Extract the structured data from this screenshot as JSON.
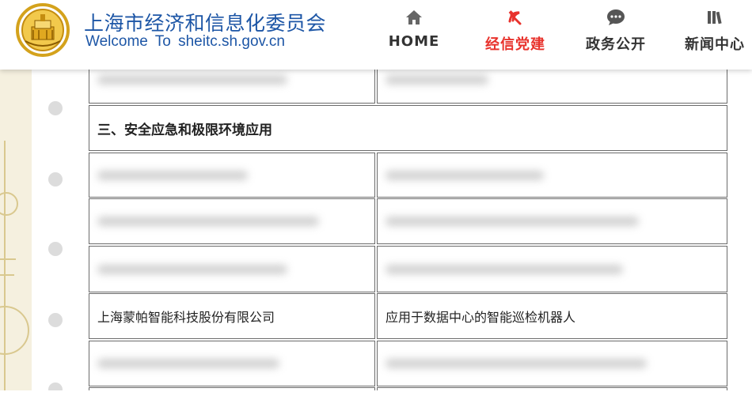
{
  "header": {
    "title": "上海市经济和信息化委员会",
    "subtitle": "Welcome To sheitc.sh.gov.cn",
    "nav": [
      {
        "id": "home",
        "label": "HOME",
        "icon": "home-icon",
        "active": false
      },
      {
        "id": "party",
        "label": "经信党建",
        "icon": "hammer-sickle-icon",
        "active": true
      },
      {
        "id": "gov",
        "label": "政务公开",
        "icon": "chat-bubble-icon",
        "active": false
      },
      {
        "id": "news",
        "label": "新闻中心",
        "icon": "books-icon",
        "active": false
      }
    ]
  },
  "colors": {
    "brand_blue": "#1d56a6",
    "active_red": "#e8322c",
    "logo_gold": "#d4a21c"
  },
  "table": {
    "section_heading": "三、安全应急和极限环境应用",
    "visible_row": {
      "company": "上海蒙帕智能科技股份有限公司",
      "product": "应用于数据中心的智能巡检机器人"
    }
  }
}
